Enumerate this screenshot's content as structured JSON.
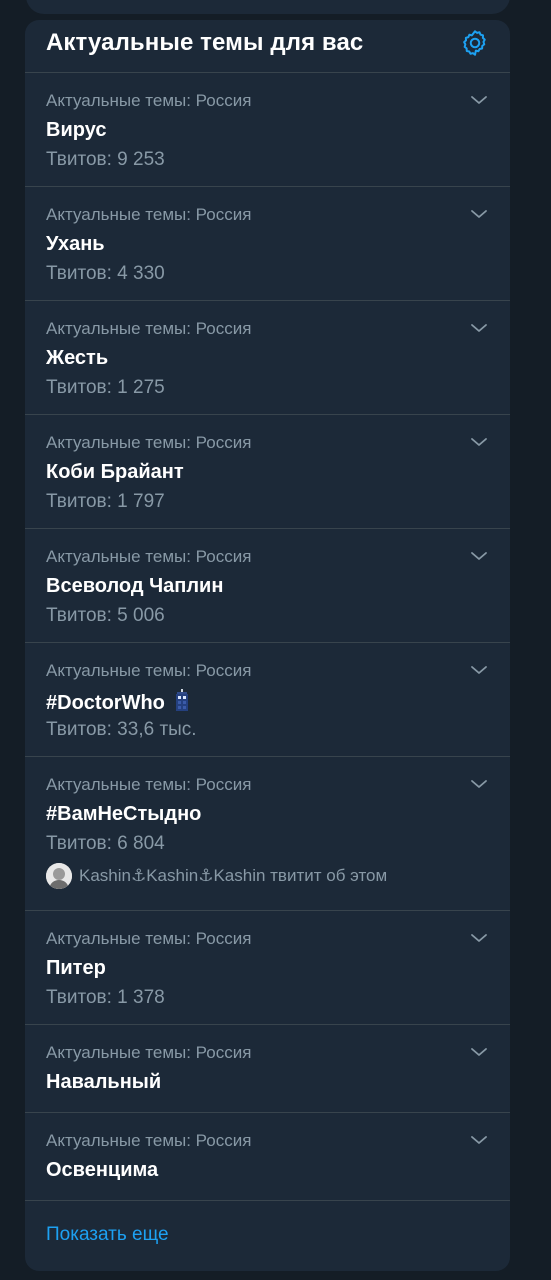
{
  "panel": {
    "title": "Актуальные темы для вас",
    "settings_icon": "gear-icon",
    "show_more_label": "Показать еще",
    "accent_color": "#1da1f2",
    "background_color": "#1c2938",
    "page_background": "#141d26"
  },
  "trends": [
    {
      "context": "Актуальные темы: Россия",
      "name": "Вирус",
      "count": "Твитов: 9 253"
    },
    {
      "context": "Актуальные темы: Россия",
      "name": "Ухань",
      "count": "Твитов: 4 330"
    },
    {
      "context": "Актуальные темы: Россия",
      "name": "Жесть",
      "count": "Твитов: 1 275"
    },
    {
      "context": "Актуальные темы: Россия",
      "name": "Коби Брайант",
      "count": "Твитов: 1 797"
    },
    {
      "context": "Актуальные темы: Россия",
      "name": "Всеволод Чаплин",
      "count": "Твитов: 5 006"
    },
    {
      "context": "Актуальные темы: Россия",
      "name": "#DoctorWho",
      "count": "Твитов: 33,6 тыс.",
      "emoji": "tardis-icon"
    },
    {
      "context": "Актуальные темы: Россия",
      "name": "#ВамНеСтыдно",
      "count": "Твитов: 6 804",
      "tweeter": "Kashin⚓Kashin⚓Kashin твитит об этом"
    },
    {
      "context": "Актуальные темы: Россия",
      "name": "Питер",
      "count": "Твитов: 1 378"
    },
    {
      "context": "Актуальные темы: Россия",
      "name": "Навальный"
    },
    {
      "context": "Актуальные темы: Россия",
      "name": "Освенцима"
    }
  ]
}
